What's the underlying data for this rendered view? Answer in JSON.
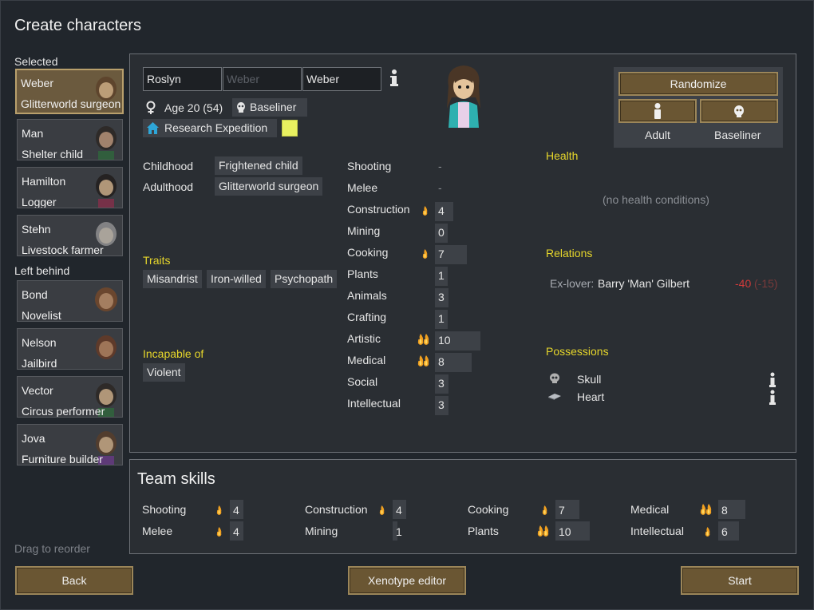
{
  "window": {
    "title": "Create characters"
  },
  "sidebar": {
    "selected_label": "Selected",
    "left_behind_label": "Left behind",
    "drag_hint": "Drag to reorder",
    "selected": [
      {
        "name": "Weber",
        "title": "Glitterworld surgeon"
      },
      {
        "name": "Man",
        "title": "Shelter child"
      },
      {
        "name": "Hamilton",
        "title": "Logger"
      },
      {
        "name": "Stehn",
        "title": "Livestock farmer"
      }
    ],
    "left_behind": [
      {
        "name": "Bond",
        "title": "Novelist"
      },
      {
        "name": "Nelson",
        "title": "Jailbird"
      },
      {
        "name": "Vector",
        "title": "Circus performer"
      },
      {
        "name": "Jova",
        "title": "Furniture builder"
      }
    ]
  },
  "pawn": {
    "first_name": "Roslyn",
    "nickname_placeholder": "Weber",
    "last_name": "Weber",
    "age": "Age 20 (54)",
    "xenotype": "Baseliner",
    "faction": "Research Expedition",
    "faction_color": "#e8f060",
    "childhood_label": "Childhood",
    "childhood": "Frightened child",
    "adulthood_label": "Adulthood",
    "adulthood": "Glitterworld surgeon",
    "traits_label": "Traits",
    "traits": [
      "Misandrist",
      "Iron-willed",
      "Psychopath"
    ],
    "incapable_label": "Incapable of",
    "incapable": [
      "Violent"
    ]
  },
  "skills": [
    {
      "name": "Shooting",
      "value": "-",
      "passion": 0
    },
    {
      "name": "Melee",
      "value": "-",
      "passion": 0
    },
    {
      "name": "Construction",
      "value": "4",
      "passion": 1
    },
    {
      "name": "Mining",
      "value": "0",
      "passion": 0
    },
    {
      "name": "Cooking",
      "value": "7",
      "passion": 1
    },
    {
      "name": "Plants",
      "value": "1",
      "passion": 0
    },
    {
      "name": "Animals",
      "value": "3",
      "passion": 0
    },
    {
      "name": "Crafting",
      "value": "1",
      "passion": 0
    },
    {
      "name": "Artistic",
      "value": "10",
      "passion": 2
    },
    {
      "name": "Medical",
      "value": "8",
      "passion": 2
    },
    {
      "name": "Social",
      "value": "3",
      "passion": 0
    },
    {
      "name": "Intellectual",
      "value": "3",
      "passion": 0
    }
  ],
  "randomize": {
    "label": "Randomize",
    "age_label": "Adult",
    "xeno_label": "Baseliner"
  },
  "health": {
    "label": "Health",
    "empty": "(no health conditions)"
  },
  "relations": {
    "label": "Relations",
    "items": [
      {
        "type": "Ex-lover:",
        "name": "Barry 'Man' Gilbert",
        "opinion": "-40",
        "opinion2": "(-15)"
      }
    ]
  },
  "possessions": {
    "label": "Possessions",
    "items": [
      {
        "name": "Skull",
        "icon": "skull-icon"
      },
      {
        "name": "Heart",
        "icon": "heart-organ-icon"
      }
    ]
  },
  "team": {
    "title": "Team skills",
    "skills": [
      {
        "name": "Shooting",
        "value": "4",
        "passion": 1
      },
      {
        "name": "Melee",
        "value": "4",
        "passion": 1
      },
      {
        "name": "Construction",
        "value": "4",
        "passion": 1
      },
      {
        "name": "Mining",
        "value": "1",
        "passion": 0
      },
      {
        "name": "Cooking",
        "value": "7",
        "passion": 1
      },
      {
        "name": "Plants",
        "value": "10",
        "passion": 2
      },
      {
        "name": "Medical",
        "value": "8",
        "passion": 2
      },
      {
        "name": "Intellectual",
        "value": "6",
        "passion": 1
      }
    ]
  },
  "footer": {
    "back": "Back",
    "xenotype_editor": "Xenotype editor",
    "start": "Start"
  },
  "colors": {
    "accent_yellow": "#e6d62b",
    "button_brown": "#6a5633",
    "negative_red": "#d03a3a"
  }
}
